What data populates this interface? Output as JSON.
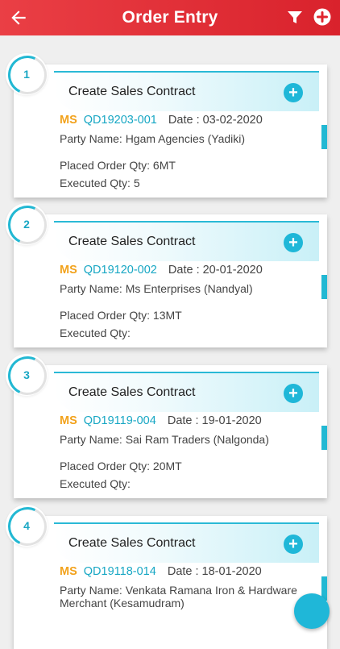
{
  "header": {
    "title": "Order Entry",
    "back_icon": "arrow-left-icon",
    "filter_icon": "filter-icon",
    "add_icon": "plus-circle-icon"
  },
  "colors": {
    "header": "#e0262f",
    "accent": "#1fb7d8",
    "ms": "#f2a21c"
  },
  "orders": [
    {
      "index": "1",
      "action": "Create Sales Contract",
      "prefix": "MS",
      "code": "QD19203-001",
      "date": "Date : 03-02-2020",
      "party": "Party Name: Hgam Agencies (Yadiki)",
      "placed": "Placed Order Qty: 6MT",
      "executed": "Executed Qty: 5"
    },
    {
      "index": "2",
      "action": "Create Sales Contract",
      "prefix": "MS",
      "code": "QD19120-002",
      "date": "Date : 20-01-2020",
      "party": "Party Name: Ms Enterprises (Nandyal)",
      "placed": "Placed Order Qty: 13MT",
      "executed": "Executed Qty:"
    },
    {
      "index": "3",
      "action": "Create Sales Contract",
      "prefix": "MS",
      "code": "QD19119-004",
      "date": "Date : 19-01-2020",
      "party": "Party Name: Sai Ram Traders (Nalgonda)",
      "placed": "Placed Order Qty: 20MT",
      "executed": "Executed Qty:"
    },
    {
      "index": "4",
      "action": "Create Sales Contract",
      "prefix": "MS",
      "code": "QD19118-014",
      "date": "Date : 18-01-2020",
      "party": "Party Name: Venkata Ramana Iron & Hardware Merchant (Kesamudram)",
      "placed": "",
      "executed": ""
    }
  ]
}
